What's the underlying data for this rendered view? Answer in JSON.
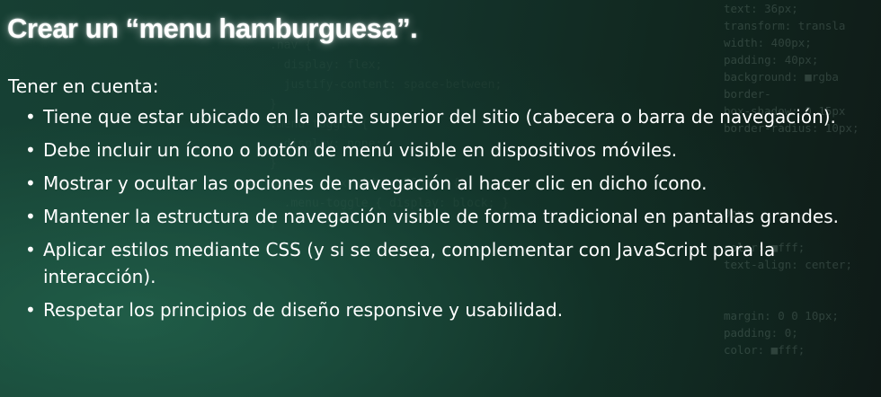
{
  "title": "Crear un “menu hamburguesa”.",
  "intro": "Tener en cuenta:",
  "bullet_glyph": "•",
  "items": [
    " Tiene que estar ubicado en la parte superior del sitio (cabecera o barra de navegación).",
    "Debe incluir un ícono o botón de menú visible en dispositivos móviles.",
    "Mostrar y ocultar las opciones de navegación al hacer clic en dicho ícono.",
    "Mantener la estructura de navegación visible de forma tradicional en pantallas grandes.",
    "Aplicar estilos mediante CSS (y si se desea, complementar con JavaScript para la interacción).",
    "Respetar los principios de diseño responsive y usabilidad."
  ],
  "background_code": [
    "text: 36px;",
    "transform: transla",
    "width: 400px;",
    "padding: 40px;",
    "background: ■rgba",
    "border-",
    "box-shadow: 0 15px",
    "border-radius: 10px;",
    "",
    "",
    "",
    "",
    "0px;",
    "",
    "color: ■fff;",
    "text-align: center;",
    "",
    "",
    "margin: 0 0 10px;",
    "padding: 0;",
    "color: ■fff;"
  ],
  "colors": {
    "background_left": "#173f33",
    "background_right": "#0f1a17",
    "text": "#ffffff"
  }
}
